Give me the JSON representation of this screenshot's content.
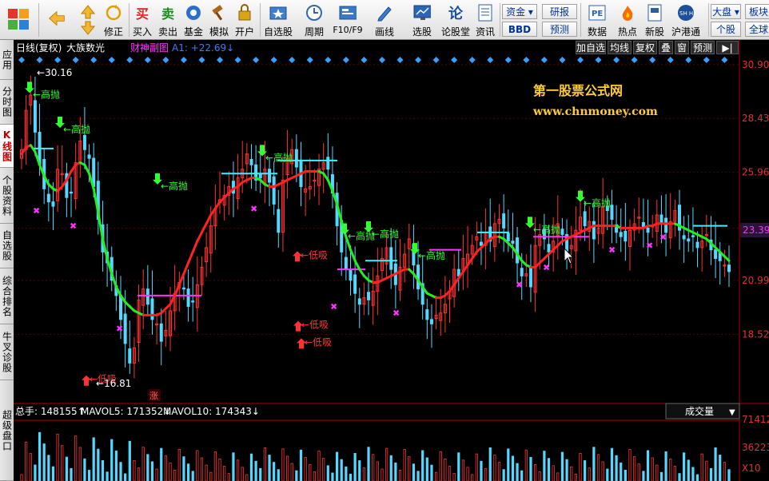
{
  "toolbar": {
    "buttons": [
      {
        "label": "",
        "icon": "menu-grid-icon"
      },
      {
        "label": "",
        "icon": "back-arrow-icon"
      },
      {
        "label": "",
        "icon": "up-down-arrow-icon"
      },
      {
        "label": "修正",
        "icon": "refresh-icon"
      },
      {
        "label": "买入",
        "icon": "buy-icon"
      },
      {
        "label": "卖出",
        "icon": "sell-icon"
      },
      {
        "label": "基金",
        "icon": "fund-icon"
      },
      {
        "label": "模拟",
        "icon": "gavel-icon"
      },
      {
        "label": "开户",
        "icon": "lock-icon"
      },
      {
        "label": "自选股",
        "icon": "star-folder-icon"
      },
      {
        "label": "周期",
        "icon": "clock-icon"
      },
      {
        "label": "F10/F9",
        "icon": "f10-icon"
      },
      {
        "label": "画线",
        "icon": "pen-icon"
      },
      {
        "label": "选股",
        "icon": "screen-icon"
      },
      {
        "label": "论股堂",
        "icon": "discuss-icon"
      },
      {
        "label": "资讯",
        "icon": "news-icon"
      },
      {
        "label": "数据",
        "icon": "pe-icon"
      },
      {
        "label": "热点",
        "icon": "hot-icon"
      },
      {
        "label": "新股",
        "icon": "new-stock-icon"
      },
      {
        "label": "沪港通",
        "icon": "shhk-icon"
      }
    ],
    "small_buttons": {
      "zijin": "资金",
      "bbd": "BBD",
      "yanbao": "研报",
      "yuce": "预测",
      "dapan": "大盘",
      "gegu": "个股",
      "bankuai": "板块",
      "quanqiu": "全球"
    }
  },
  "sidebar": {
    "tabs": [
      "应用",
      "分时图",
      "K线图",
      "个股资料",
      "自选股",
      "综合排名",
      "牛叉诊股",
      "超级盘口"
    ],
    "active_index": 2
  },
  "chart_header": {
    "period": "日线(复权)",
    "name": "大族数光",
    "formula": "财神副图",
    "a1": "A1: +22.69↓"
  },
  "chart_buttons": [
    "加自选",
    "均线",
    "复权",
    "叠",
    "窗",
    "预测"
  ],
  "watermark": {
    "line1": "第一股票公式网",
    "line2": "www.chnmoney.com"
  },
  "price_axis": {
    "ticks": [
      "30.90",
      "28.43",
      "25.96",
      "23.39",
      "20.99",
      "18.52"
    ],
    "current": "23.39"
  },
  "annotations": {
    "high_label": "30.16",
    "low_label": "16.81",
    "sell_signal": "高抛",
    "buy_signal": "低吸",
    "zhang": "涨"
  },
  "volume": {
    "total": "总手: 148155↑",
    "mavol5": "MAVOL5: 171352↓",
    "mavol10": "MAVOL10: 174343↓",
    "dropdown": "成交量",
    "ticks": [
      "71412",
      "36223",
      "X10"
    ]
  },
  "colors": {
    "up": "#ff3333",
    "down": "#55d8ff",
    "ma_up": "#ff2222",
    "ma_down": "#22ee22",
    "marker_diamond": "#3aa0ff",
    "magenta": "#ff33ff",
    "cyan_line": "#40f0ff",
    "signal_green": "#33ff33"
  },
  "chart_data": {
    "type": "candlestick",
    "y_range": [
      15.6,
      31.3
    ],
    "closes": [
      27.0,
      28.8,
      29.5,
      27.8,
      26.3,
      25.2,
      24.6,
      24.4,
      26.1,
      25.9,
      24.8,
      25.0,
      26.4,
      27.4,
      27.0,
      26.6,
      25.3,
      23.8,
      22.3,
      21.8,
      21.0,
      20.3,
      19.2,
      18.1,
      17.2,
      17.9,
      20.1,
      20.6,
      19.9,
      19.2,
      19.0,
      18.2,
      18.7,
      19.6,
      20.4,
      20.9,
      20.6,
      19.8,
      20.0,
      20.8,
      21.6,
      22.5,
      23.5,
      24.3,
      24.7,
      24.9,
      25.3,
      25.0,
      25.7,
      26.1,
      26.8,
      26.3,
      25.6,
      25.7,
      26.1,
      25.5,
      24.5,
      23.2,
      25.6,
      26.6,
      27.0,
      26.2,
      25.3,
      25.2,
      25.3,
      25.6,
      26.1,
      26.4,
      26.1,
      25.0,
      23.5,
      22.3,
      21.5,
      21.0,
      20.4,
      19.9,
      20.2,
      20.1,
      20.5,
      21.2,
      22.0,
      22.5,
      21.5,
      20.8,
      21.6,
      22.2,
      22.9,
      21.7,
      20.6,
      19.9,
      19.2,
      19.0,
      19.4,
      19.5,
      19.9,
      20.5,
      21.5,
      21.2,
      22.0,
      22.2,
      22.6,
      23.0,
      22.6,
      23.2,
      22.8,
      23.6,
      23.8,
      23.4,
      22.8,
      22.7,
      21.8,
      21.2,
      21.3,
      20.7,
      22.6,
      23.1,
      22.9,
      22.3,
      22.8,
      23.6,
      23.1,
      22.2,
      22.6,
      23.3,
      23.9,
      23.5,
      23.7,
      22.9,
      23.4,
      24.4,
      24.2,
      23.8,
      23.2,
      23.0,
      22.8,
      23.3,
      23.6,
      23.9,
      23.4,
      23.2,
      23.5,
      24.0,
      23.6,
      23.2,
      23.7,
      24.2,
      23.3,
      22.9,
      22.8,
      23.0,
      22.5,
      22.8,
      23.1,
      22.4,
      22.0,
      21.9,
      21.7,
      21.4
    ],
    "ma": [
      26.8,
      27.1,
      27.2,
      26.9,
      26.3,
      25.8,
      25.4,
      25.2,
      25.1,
      25.3,
      25.6,
      26.0,
      26.3,
      26.4,
      26.3,
      25.9,
      25.2,
      24.1,
      22.9,
      22.0,
      21.3,
      20.7,
      20.3,
      20.0,
      19.8,
      19.6,
      19.5,
      19.4,
      19.4,
      19.4,
      19.4,
      19.5,
      19.7,
      19.9,
      20.3,
      20.8,
      21.3,
      21.8,
      22.3,
      22.8,
      23.2,
      23.6,
      24.0,
      24.3,
      24.6,
      24.8,
      25.0,
      25.2,
      25.3,
      25.5,
      25.6,
      25.7,
      25.7,
      25.6,
      25.4,
      25.3,
      25.3,
      25.4,
      25.5,
      25.6,
      25.7,
      25.8,
      25.9,
      26.0,
      26.0,
      26.0,
      26.0,
      25.9,
      25.6,
      25.1,
      24.5,
      23.7,
      23.0,
      22.4,
      21.9,
      21.5,
      21.2,
      21.0,
      20.9,
      20.9,
      21.0,
      21.1,
      21.2,
      21.3,
      21.4,
      21.5,
      21.5,
      21.3,
      21.0,
      20.7,
      20.4,
      20.3,
      20.2,
      20.2,
      20.3,
      20.5,
      20.8,
      21.1,
      21.4,
      21.7,
      22.0,
      22.3,
      22.5,
      22.7,
      22.9,
      23.0,
      23.0,
      22.9,
      22.7,
      22.5,
      22.2,
      21.9,
      21.7,
      21.6,
      21.6,
      21.8,
      22.0,
      22.2,
      22.4,
      22.6,
      22.8,
      22.9,
      23.0,
      23.1,
      23.2,
      23.3,
      23.4,
      23.5,
      23.5,
      23.5,
      23.5,
      23.5,
      23.5,
      23.4,
      23.4,
      23.4,
      23.4,
      23.4,
      23.4,
      23.5,
      23.5,
      23.6,
      23.6,
      23.6,
      23.6,
      23.6,
      23.5,
      23.4,
      23.3,
      23.2,
      23.1,
      23.0,
      22.9,
      22.7,
      22.5,
      22.3,
      22.1,
      21.9
    ]
  }
}
